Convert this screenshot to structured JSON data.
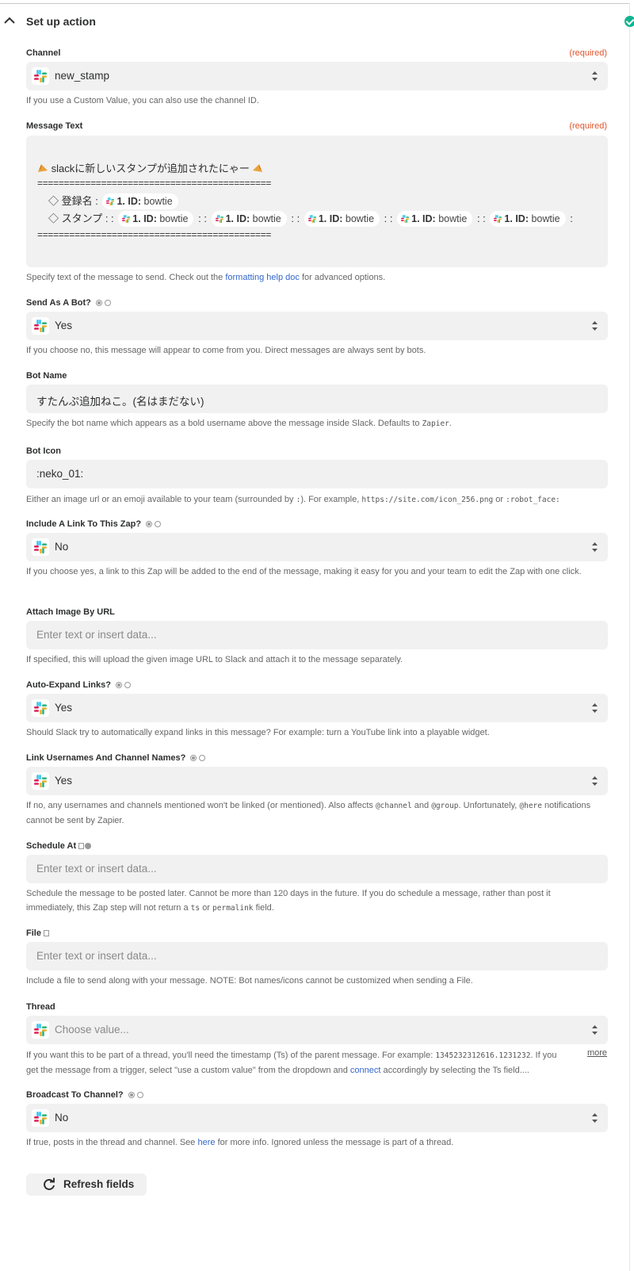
{
  "section": {
    "title": "Set up action"
  },
  "required_label": "(required)",
  "channel": {
    "label": "Channel",
    "value": "new_stamp",
    "help": "If you use a Custom Value, you can also use the channel ID."
  },
  "message_text": {
    "label": "Message Text",
    "line1_text": "slackに新しいスタンプが追加されたにゃー",
    "separator": "============================================",
    "row_registered_label": "◇ 登録名 :",
    "row_stamp_label": "◇ スタンプ : :",
    "pill_prefix": "1. ID:",
    "pill_value": "bowtie",
    "colon_sep": ": :",
    "colon_end": ":",
    "help_before": "Specify text of the message to send. Check out the",
    "help_link": "formatting help doc",
    "help_after": "for advanced options."
  },
  "send_as_bot": {
    "label": "Send As A Bot?",
    "value": "Yes",
    "help": "If you choose no, this message will appear to come from you. Direct messages are always sent by bots."
  },
  "bot_name": {
    "label": "Bot Name",
    "value": "すたんぷ追加ねこ。(名はまだない)",
    "help_before": "Specify the bot name which appears as a bold username above the message inside Slack. Defaults to",
    "help_code": "Zapier",
    "help_after": "."
  },
  "bot_icon": {
    "label": "Bot Icon",
    "value": ":neko_01:",
    "help_before": "Either an image url or an emoji available to your team (surrounded by",
    "help_code1": ":",
    "help_mid": "). For example,",
    "help_code2": "https://site.com/icon_256.png",
    "help_or": "or",
    "help_code3": ":robot_face:"
  },
  "include_link": {
    "label": "Include A Link To This Zap?",
    "value": "No",
    "help": "If you choose yes, a link to this Zap will be added to the end of the message, making it easy for you and your team to edit the Zap with one click."
  },
  "attach_image": {
    "label": "Attach Image By URL",
    "placeholder": "Enter text or insert data...",
    "help": "If specified, this will upload the given image URL to Slack and attach it to the message separately."
  },
  "auto_expand": {
    "label": "Auto-Expand Links?",
    "value": "Yes",
    "help": "Should Slack try to automatically expand links in this message? For example: turn a YouTube link into a playable widget."
  },
  "link_usernames": {
    "label": "Link Usernames And Channel Names?",
    "value": "Yes",
    "help_before": "If no, any usernames and channels mentioned won't be linked (or mentioned). Also affects",
    "help_code1": "@channel",
    "help_and": "and",
    "help_code2": "@group",
    "help_mid": ". Unfortunately,",
    "help_code3": "@here",
    "help_after": "notifications cannot be sent by Zapier."
  },
  "schedule_at": {
    "label": "Schedule At",
    "placeholder": "Enter text or insert data...",
    "help_before": "Schedule the message to be posted later. Cannot be more than 120 days in the future. If you do schedule a message, rather than post it immediately, this Zap step will not return a",
    "help_code1": "ts",
    "help_or": "or",
    "help_code2": "permalink",
    "help_after": "field."
  },
  "file": {
    "label": "File",
    "placeholder": "Enter text or insert data...",
    "help": "Include a file to send along with your message. NOTE: Bot names/icons cannot be customized when sending a File."
  },
  "thread": {
    "label": "Thread",
    "placeholder": "Choose value...",
    "help_before": "If you want this to be part of a thread, you'll need the timestamp (Ts) of the parent message. For example:",
    "help_code": "1345232312616.1231232",
    "help_mid": ". If you get the message from a trigger, select \"use a custom value\" from the dropdown and",
    "help_link": "connect",
    "help_after": "accordingly by selecting the Ts field....",
    "more": "more"
  },
  "broadcast": {
    "label": "Broadcast To Channel?",
    "value": "No",
    "help_before": "If true, posts in the thread and channel. See",
    "help_link": "here",
    "help_after": "for more info. Ignored unless the message is part of a thread."
  },
  "refresh": {
    "label": "Refresh fields"
  },
  "colors": {
    "accent_required": "#e0562d",
    "link": "#3366cc",
    "field_bg": "#f1f1f1",
    "success": "#13b491"
  }
}
